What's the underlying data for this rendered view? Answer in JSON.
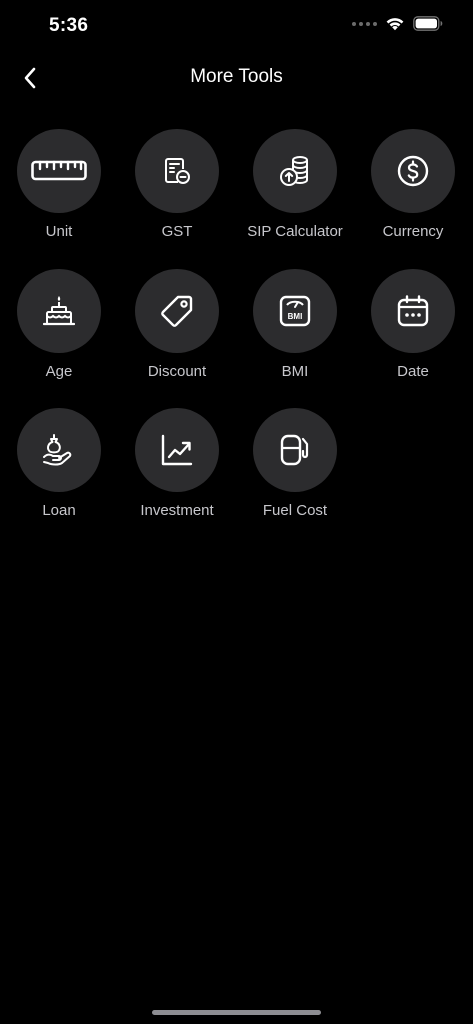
{
  "status_bar": {
    "time": "5:36"
  },
  "nav": {
    "title": "More Tools"
  },
  "tools": [
    {
      "label": "Unit",
      "icon": "ruler-icon"
    },
    {
      "label": "GST",
      "icon": "receipt-icon"
    },
    {
      "label": "SIP Calculator",
      "icon": "coins-growth-icon"
    },
    {
      "label": "Currency",
      "icon": "dollar-circle-icon"
    },
    {
      "label": "Age",
      "icon": "birthday-cake-icon"
    },
    {
      "label": "Discount",
      "icon": "price-tag-icon"
    },
    {
      "label": "BMI",
      "icon": "bmi-scale-icon",
      "icon_text": "BMI"
    },
    {
      "label": "Date",
      "icon": "calendar-icon"
    },
    {
      "label": "Loan",
      "icon": "money-bag-hand-icon"
    },
    {
      "label": "Investment",
      "icon": "trend-chart-icon"
    },
    {
      "label": "Fuel Cost",
      "icon": "fuel-pump-icon"
    }
  ],
  "colors": {
    "background": "#000000",
    "tile": "#2c2c2e",
    "label": "#c7c7cc",
    "icon": "#ffffff"
  }
}
